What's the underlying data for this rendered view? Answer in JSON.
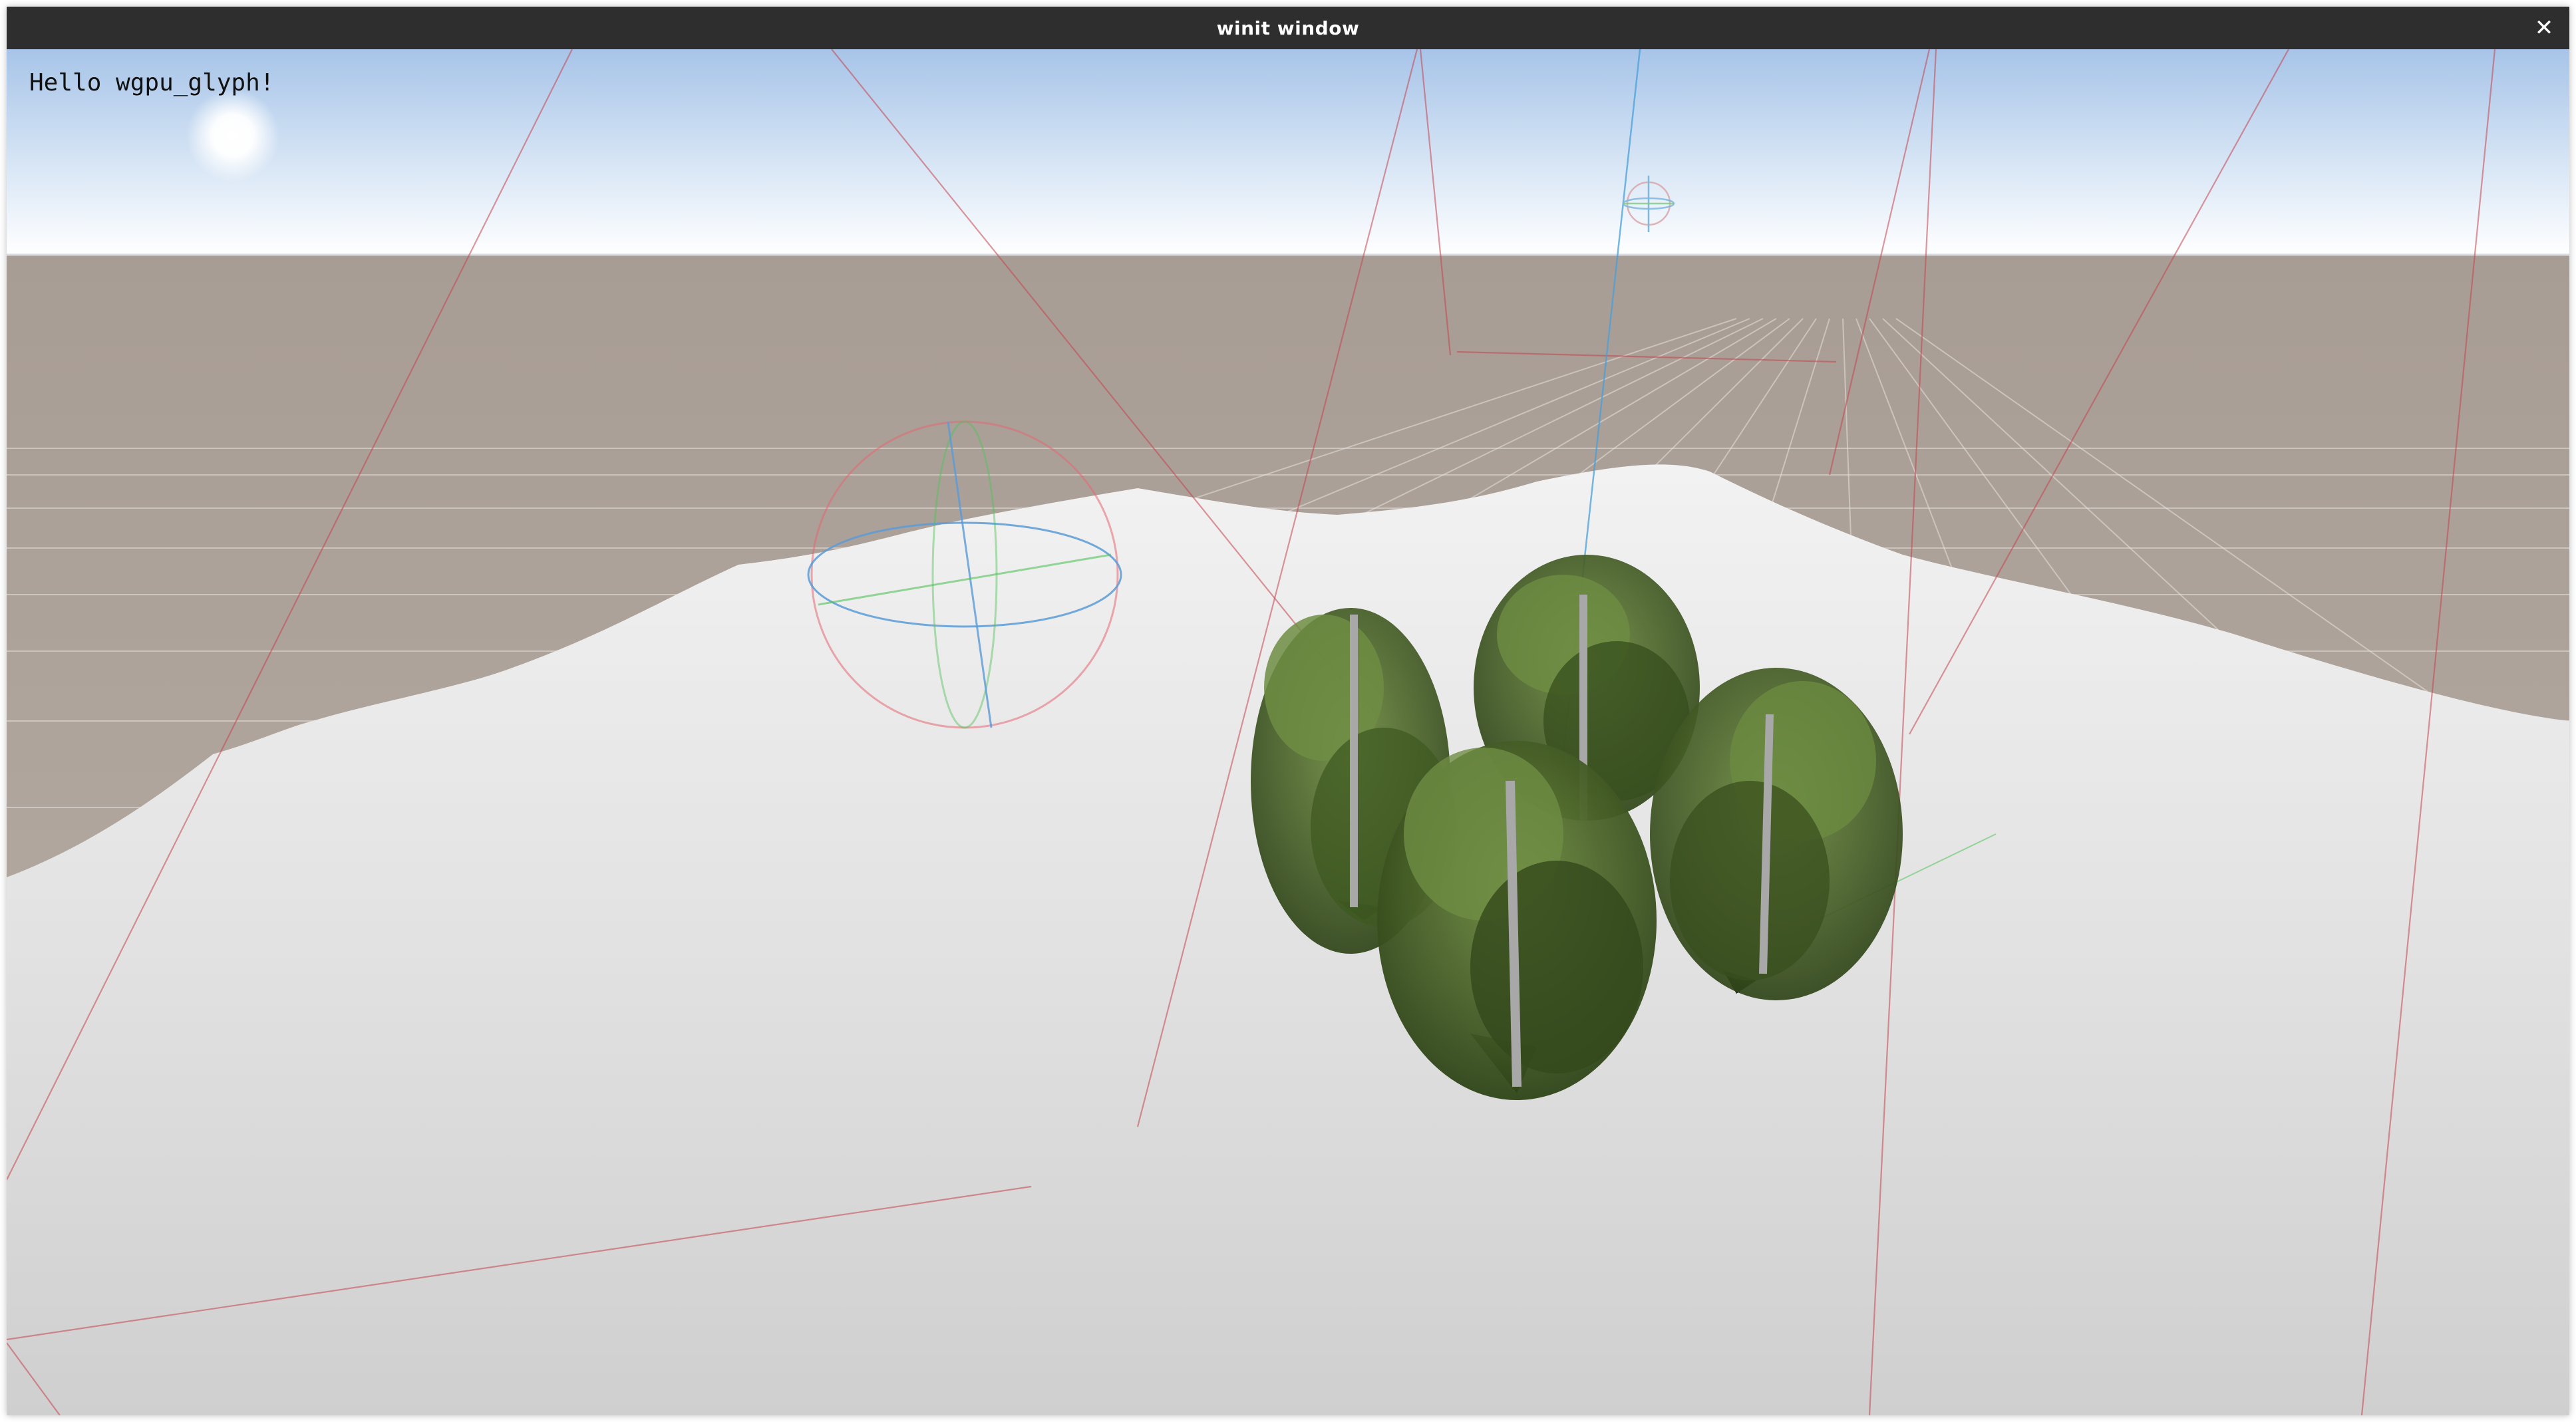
{
  "window": {
    "title": "winit window",
    "close_glyph": "✕"
  },
  "viewport": {
    "overlay_text": "Hello wgpu_glyph!"
  },
  "colors": {
    "sky_top": "#a9c6ea",
    "sky_horizon": "#ffffff",
    "ground": "#b0a69d",
    "terrain": "#e9e9e9",
    "foliage": "#5b7a34",
    "debug_red": "#c4434f",
    "debug_blue": "#4a9fd8",
    "debug_green": "#52c25a"
  },
  "icons": {
    "close": "close-icon",
    "sun": "sun",
    "gizmo": "light-gizmo-icon"
  }
}
